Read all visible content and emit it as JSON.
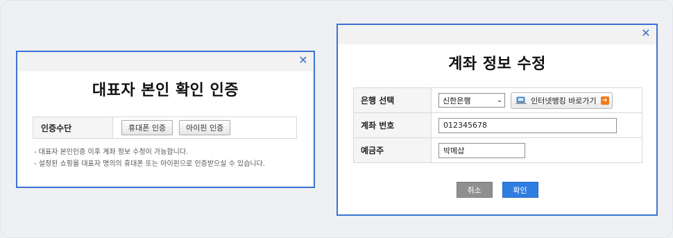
{
  "auth_dialog": {
    "title": "대표자 본인 확인 인증",
    "method_label": "인증수단",
    "phone_button": "휴대폰 인증",
    "ipin_button": "아이핀 인증",
    "notes": [
      "- 대표자 본인인증 이후 계좌 정보 수정이 가능합니다.",
      "- 설정된 쇼핑몰 대표자 명의의 휴대폰 또는 아이핀으로 인증받으실 수 있습니다."
    ]
  },
  "account_dialog": {
    "title": "계좌 정보 수정",
    "bank_label": "은행 선택",
    "bank_selected": "신한은행",
    "netbank_button": "인터넷뱅킹 바로가기",
    "account_label": "계좌 번호",
    "account_value": "012345678",
    "holder_label": "예금주",
    "holder_value": "박메샵",
    "cancel_button": "취소",
    "ok_button": "확인"
  },
  "colors": {
    "window_border": "#3b72d2",
    "ok_button": "#2f7de1",
    "cancel_button": "#8f8f8f",
    "netbank_arrow": "#f07a1a"
  },
  "icons": [
    "close-icon",
    "chevron-down-icon",
    "computer-icon",
    "arrow-right-icon"
  ]
}
